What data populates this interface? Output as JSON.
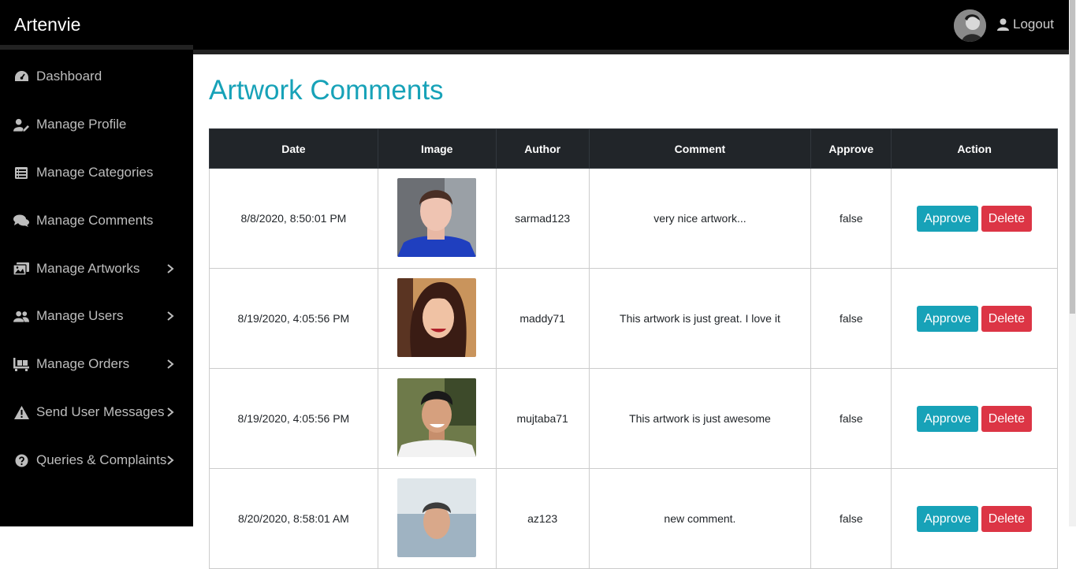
{
  "app": {
    "brand": "Artenvie",
    "logout_label": "Logout"
  },
  "sidebar": {
    "items": [
      {
        "label": "Dashboard",
        "icon": "dashboard-icon",
        "has_submenu": false
      },
      {
        "label": "Manage Profile",
        "icon": "user-edit-icon",
        "has_submenu": false
      },
      {
        "label": "Manage Categories",
        "icon": "list-icon",
        "has_submenu": false
      },
      {
        "label": "Manage Comments",
        "icon": "comments-icon",
        "has_submenu": false
      },
      {
        "label": "Manage Artworks",
        "icon": "images-icon",
        "has_submenu": true
      },
      {
        "label": "Manage Users",
        "icon": "users-icon",
        "has_submenu": true
      },
      {
        "label": "Manage Orders",
        "icon": "pallet-icon",
        "has_submenu": true
      },
      {
        "label": "Send User Messages",
        "icon": "warning-icon",
        "has_submenu": true
      },
      {
        "label": "Queries & Complaints",
        "icon": "question-icon",
        "has_submenu": true
      }
    ]
  },
  "main": {
    "title": "Artwork Comments",
    "table": {
      "headers": [
        "Date",
        "Image",
        "Author",
        "Comment",
        "Approve",
        "Action"
      ],
      "approve_label": "Approve",
      "delete_label": "Delete",
      "rows": [
        {
          "date": "8/8/2020, 8:50:01 PM",
          "author": "sarmad123",
          "comment": "very nice artwork...",
          "approve": "false"
        },
        {
          "date": "8/19/2020, 4:05:56 PM",
          "author": "maddy71",
          "comment": "This artwork is just great. I love it",
          "approve": "false"
        },
        {
          "date": "8/19/2020, 4:05:56 PM",
          "author": "mujtaba71",
          "comment": "This artwork is just awesome",
          "approve": "false"
        },
        {
          "date": "8/20/2020, 8:58:01 AM",
          "author": "az123",
          "comment": "new comment.",
          "approve": "false"
        }
      ]
    }
  },
  "colors": {
    "accent": "#17a2b8",
    "danger": "#dc3545",
    "header_dark": "#212529",
    "sidebar_bg": "#000000"
  }
}
